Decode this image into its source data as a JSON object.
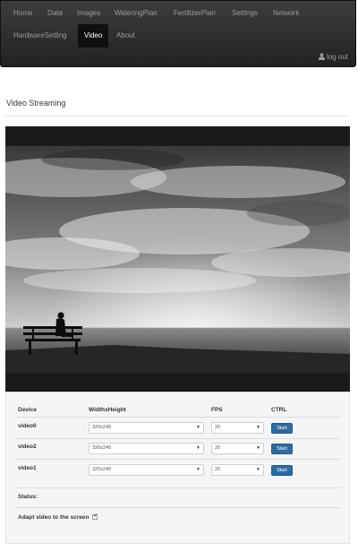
{
  "nav": {
    "items": [
      {
        "label": "Home"
      },
      {
        "label": "Data"
      },
      {
        "label": "Images"
      },
      {
        "label": "WateringPlan"
      },
      {
        "label": "FertilizerPlan"
      },
      {
        "label": "Settings"
      },
      {
        "label": "Network"
      },
      {
        "label": "HardwareSetting"
      },
      {
        "label": "Video",
        "active": true
      },
      {
        "label": "About"
      }
    ],
    "logout_label": "log out",
    "logout_icon": "user-icon"
  },
  "page": {
    "title": "Video Streaming"
  },
  "table": {
    "headers": {
      "device": "Device",
      "resolution": "WidthxHeight",
      "fps": "FPS",
      "ctrl": "CTRL"
    },
    "rows": [
      {
        "device": "video0",
        "resolution": "320x240",
        "fps": "20",
        "button": "Start"
      },
      {
        "device": "video2",
        "resolution": "320x240",
        "fps": "20",
        "button": "Start"
      },
      {
        "device": "video1",
        "resolution": "320x240",
        "fps": "20",
        "button": "Start"
      }
    ],
    "status_label": "Status:",
    "adapt_label": "Adapt video to the screen",
    "adapt_checked": true
  },
  "colors": {
    "navbar": "#222222",
    "button": "#2d6ca2",
    "panel": "#f5f5f5"
  }
}
